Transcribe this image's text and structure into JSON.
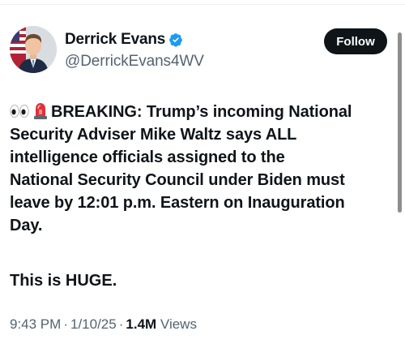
{
  "author": {
    "display_name": "Derrick Evans",
    "handle": "@DerrickEvans4WV",
    "verified_icon": "verified-badge-icon",
    "verified_color": "#1d9bf0"
  },
  "actions": {
    "follow_label": "Follow"
  },
  "tweet": {
    "lines": [
      "BREAKING: Trump’s incoming National",
      "Security Adviser Mike Waltz says ALL",
      "intelligence officials assigned to the",
      "National Security Council under Biden must",
      "leave by 12:01 p.m. Eastern on Inauguration",
      "Day."
    ],
    "leading_emojis": [
      "eyes-emoji",
      "siren-emoji"
    ],
    "closing_line": "This is HUGE."
  },
  "meta": {
    "time": "9:43 PM",
    "date": "1/10/25",
    "views_count": "1.4M",
    "views_label": "Views",
    "separator": "·"
  },
  "colors": {
    "text": "#0f1419",
    "secondary": "#536471",
    "button_bg": "#0f1419",
    "button_text": "#ffffff"
  }
}
